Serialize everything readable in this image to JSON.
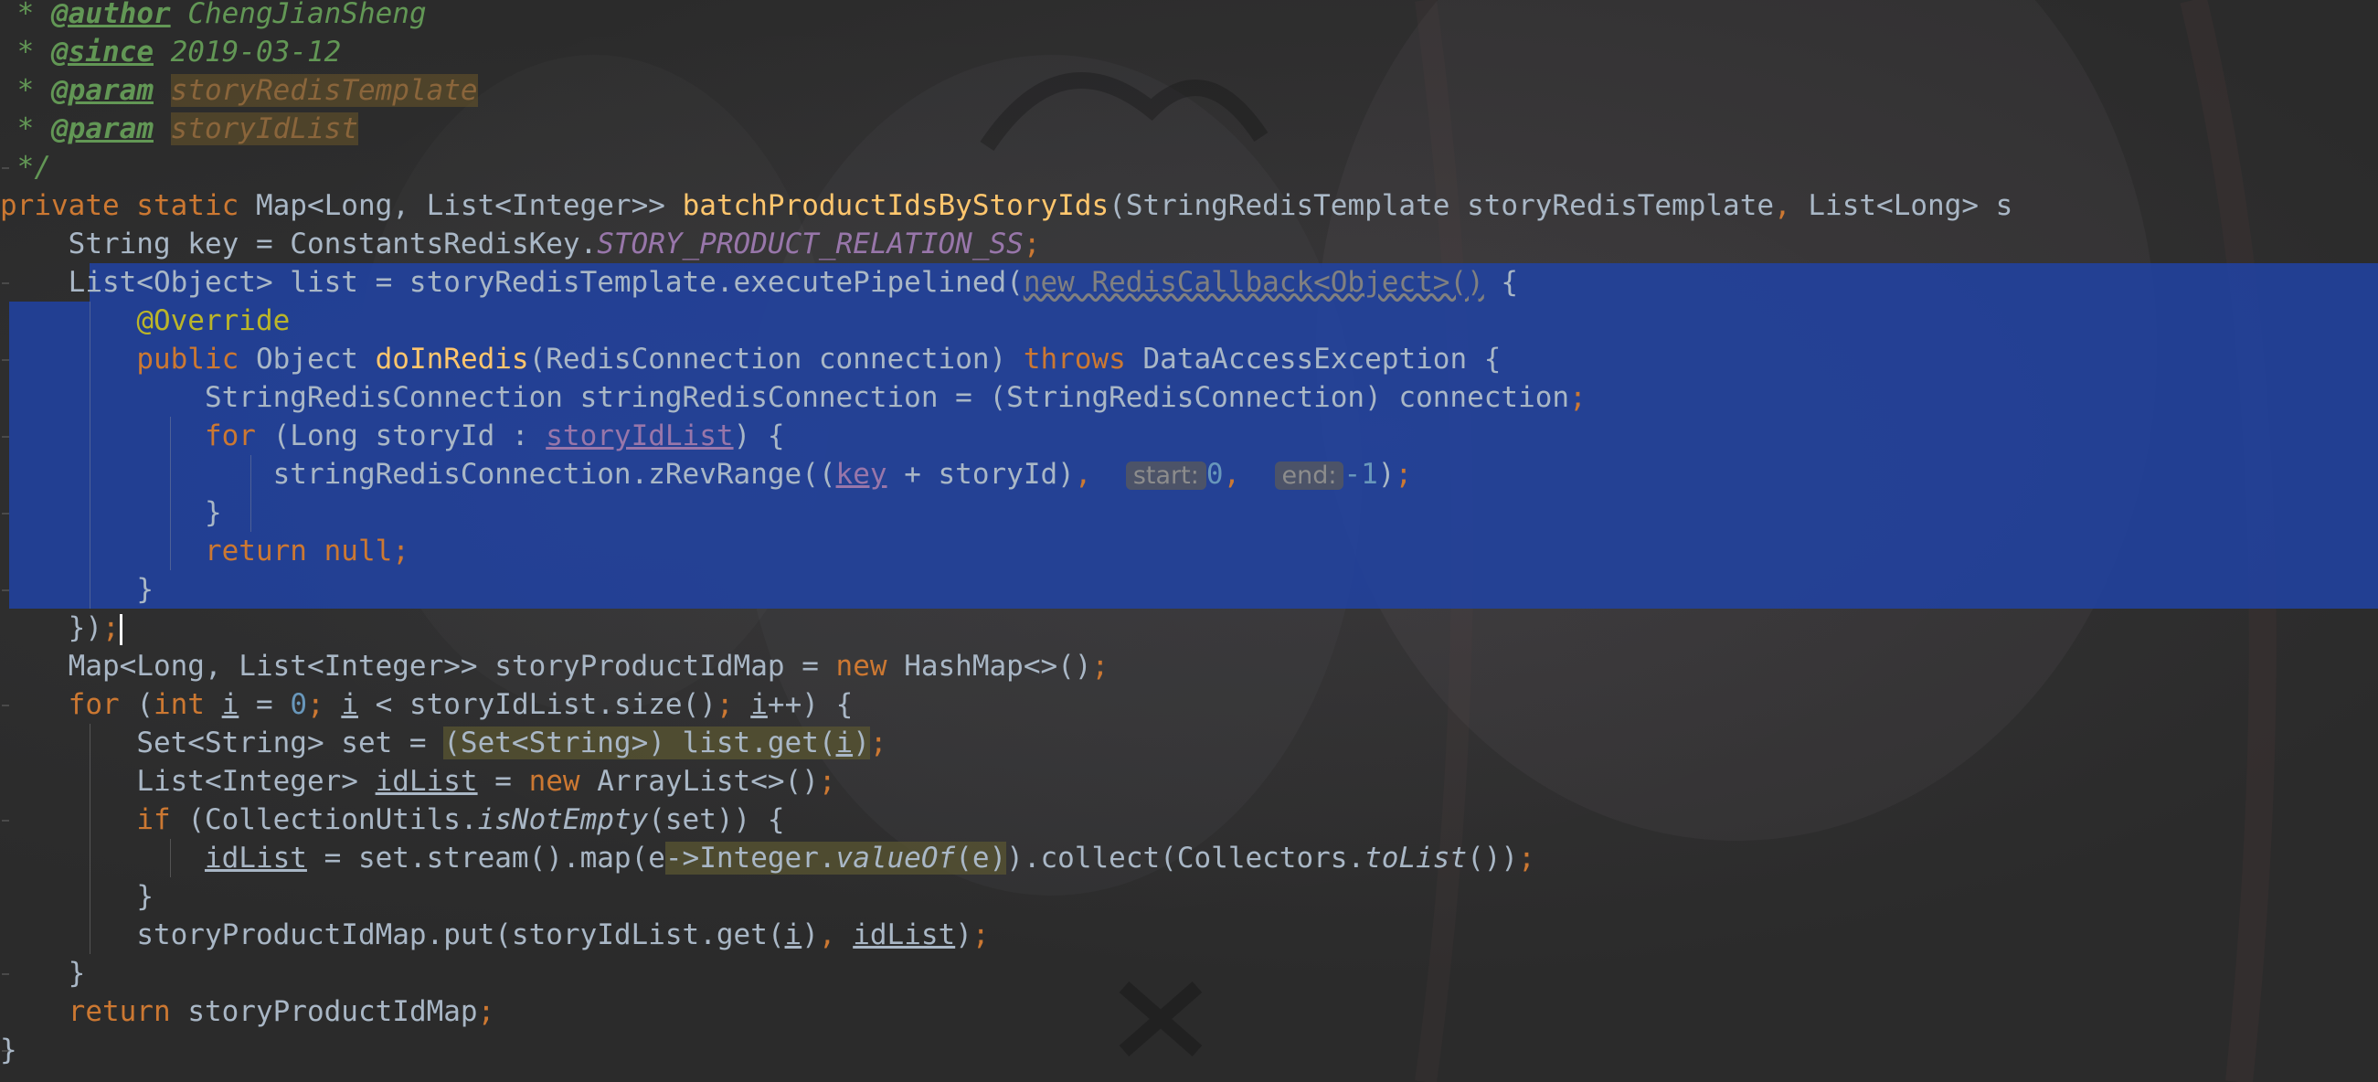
{
  "editor": {
    "theme_colors": {
      "background": "#2b2b2b",
      "default_text": "#a9b7c6",
      "keyword": "#cc7832",
      "method": "#ffc66d",
      "comment": "#629755",
      "constant": "#9876aa",
      "annotation": "#bbb529",
      "number": "#6897bb",
      "selection": "#2142a0"
    },
    "lines": {
      "l1": {
        "star": " * ",
        "tag": "@author",
        "rest": " ChengJianSheng"
      },
      "l2": {
        "star": " * ",
        "tag": "@since",
        "rest": " 2019-03-12"
      },
      "l3": {
        "star": " * ",
        "tag": "@param",
        "sp": " ",
        "param": "storyRedisTemplate"
      },
      "l4": {
        "star": " * ",
        "tag": "@param",
        "sp": " ",
        "param": "storyIdList"
      },
      "l5": {
        "text": " */"
      },
      "l6": {
        "kw1": "private static ",
        "t1": "Map<Long, List<Integer>> ",
        "fn": "batchProductIdsByStoryIds",
        "t2": "(StringRedisTemplate storyRedisTemplate",
        "comma": ", ",
        "t3": "List<Long> s"
      },
      "l7": {
        "indent": "    ",
        "t1": "String key = ConstantsRedisKey.",
        "const": "STORY_PRODUCT_RELATION_SS",
        "semi": ";"
      },
      "l8": {
        "indent": "    ",
        "t1": "List<Object> list = storyRedisTemplate.executePipelined(",
        "wavy": "new RedisCallback<Object>()",
        "t2": " {"
      },
      "l9": {
        "indent": "        ",
        "ann": "@Override"
      },
      "l10": {
        "indent": "        ",
        "kw1": "public ",
        "t1": "Object ",
        "fn": "doInRedis",
        "t2": "(RedisConnection connection) ",
        "kw2": "throws ",
        "t3": "DataAccessException {"
      },
      "l11": {
        "indent": "            ",
        "t1": "StringRedisConnection stringRedisConnection = (StringRedisConnection) connection",
        "semi": ";"
      },
      "l12": {
        "indent": "            ",
        "kw1": "for ",
        "t1": "(Long storyId : ",
        "field": "storyIdList",
        "t2": ") {"
      },
      "l13": {
        "indent": "                ",
        "t1": "stringRedisConnection.zRevRange((",
        "field": "key",
        "t2": " + storyId)",
        "comma1": ",  ",
        "hint1": "start:",
        "n1": "0",
        "comma2": ",  ",
        "hint2": "end:",
        "n2": "-1",
        "t3": ")",
        "semi": ";"
      },
      "l14": {
        "indent": "            ",
        "t1": "}"
      },
      "l15": {
        "indent": "            ",
        "kw1": "return null",
        "semi": ";"
      },
      "l16": {
        "indent": "        ",
        "t1": "}"
      },
      "l17": {
        "indent": "    ",
        "t1": "})",
        "semi": ";"
      },
      "l18": {
        "indent": "    ",
        "t1": "Map<Long, List<Integer>> storyProductIdMap = ",
        "kw1": "new ",
        "t2": "HashMap<>()",
        "semi": ";"
      },
      "l19": {
        "indent": "    ",
        "kw1": "for ",
        "t1": "(",
        "kw2": "int ",
        "v1": "i",
        "t2": " = ",
        "n1": "0",
        "s1": "; ",
        "v2": "i",
        "t3": " < storyIdList.size()",
        "s2": "; ",
        "v3": "i",
        "t4": "++) {"
      },
      "l20": {
        "indent": "        ",
        "t1": "Set<String> set = ",
        "hl1": "(Set<String>) list.get(",
        "v1": "i",
        "hl2": ")",
        "semi": ";"
      },
      "l21": {
        "indent": "        ",
        "t1": "List<Integer> ",
        "v1": "idList",
        "t2": " = ",
        "kw1": "new ",
        "t3": "ArrayList<>()",
        "semi": ";"
      },
      "l22": {
        "indent": "        ",
        "kw1": "if ",
        "t1": "(CollectionUtils.",
        "st": "isNotEmpty",
        "t2": "(set)) {"
      },
      "l23": {
        "indent": "            ",
        "v1": "idList",
        "t1": " = set.stream().map(e",
        "hl1": "->Integer.",
        "st": "valueOf",
        "hl2": "(e)",
        "t2": ").collect(Collectors.",
        "st2": "toList",
        "t3": "())",
        "semi": ";"
      },
      "l24": {
        "indent": "        ",
        "t1": "}"
      },
      "l25": {
        "indent": "        ",
        "t1": "storyProductIdMap.put(storyIdList.get(",
        "v1": "i",
        "t2": ")",
        "comma": ", ",
        "v2": "idList",
        "t3": ")",
        "semi": ";"
      },
      "l26": {
        "indent": "    ",
        "t1": "}"
      },
      "l27": {
        "indent": "    ",
        "kw1": "return ",
        "t1": "storyProductIdMap",
        "semi": ";"
      },
      "l28": {
        "text": "}"
      }
    }
  }
}
